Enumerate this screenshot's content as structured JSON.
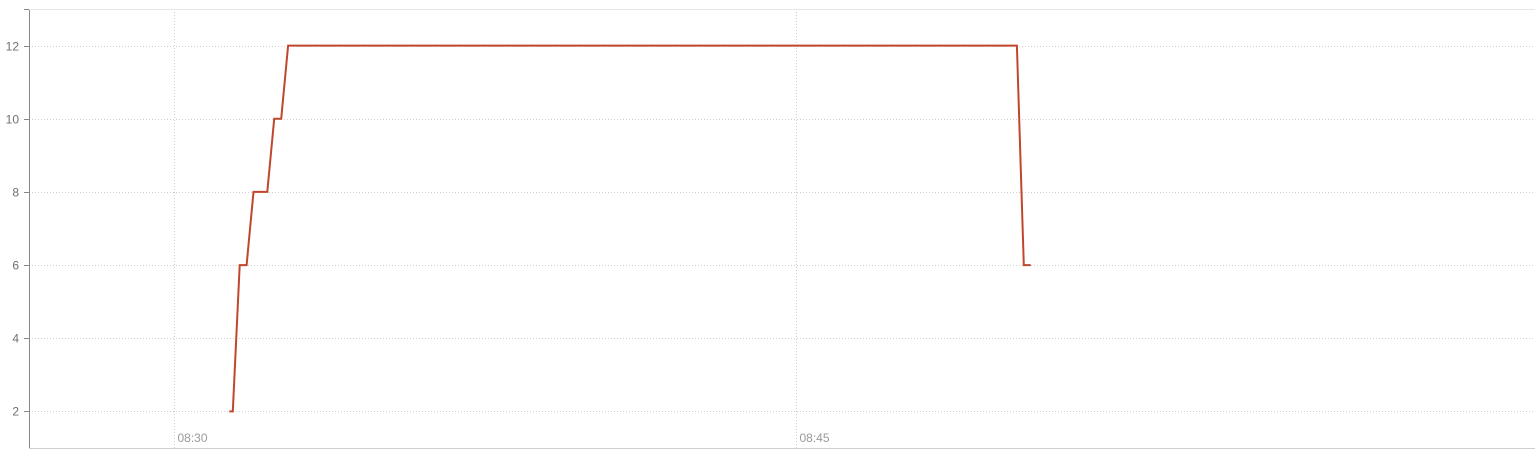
{
  "chart_data": {
    "type": "line",
    "title": "",
    "xlabel": "",
    "ylabel": "",
    "x_ticks": [
      "08:30",
      "08:45"
    ],
    "y_ticks": [
      2,
      4,
      6,
      8,
      10,
      12
    ],
    "xlim": [
      "08:26:30",
      "09:02:50"
    ],
    "ylim": [
      1,
      13
    ],
    "grid": true,
    "line_style": "step",
    "colors": {
      "series": "#c0472d",
      "grid": "#cfcfcf",
      "axis": "#888888"
    },
    "series": [
      {
        "x": [
          "08:31:20",
          "08:31:25",
          "08:31:35",
          "08:31:45",
          "08:31:55",
          "08:32:05",
          "08:32:15",
          "08:32:25",
          "08:32:35",
          "08:32:45",
          "08:33:00",
          "08:50:20",
          "08:50:30",
          "08:50:40"
        ],
        "y": [
          2,
          2,
          6,
          6,
          8,
          8,
          8,
          10,
          10,
          12,
          12,
          12,
          6,
          6
        ]
      }
    ]
  }
}
